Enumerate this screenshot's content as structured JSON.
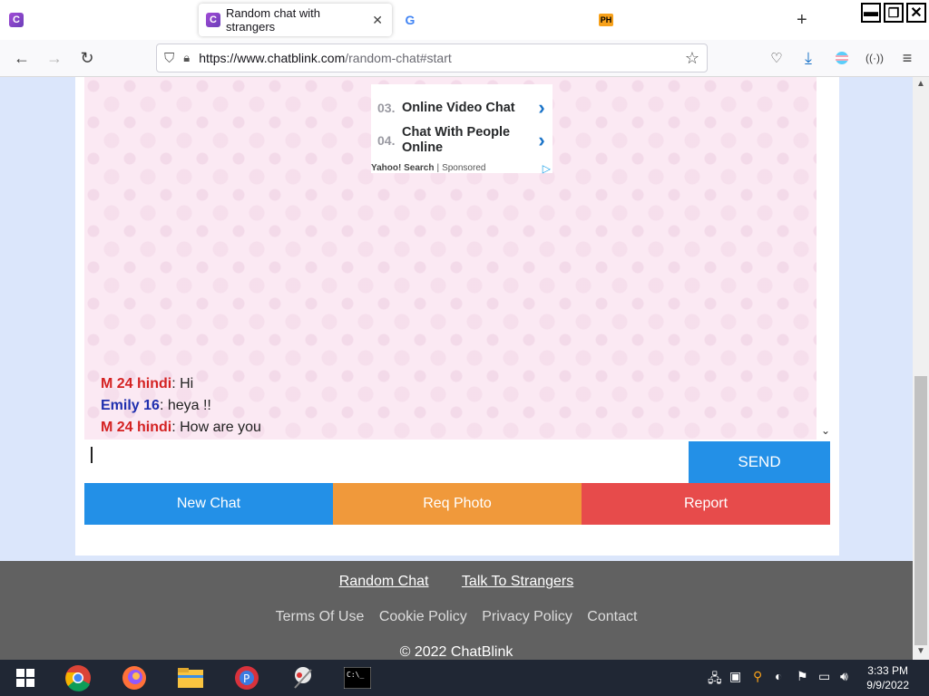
{
  "browser": {
    "tabs": [
      {
        "title": "",
        "favicon": "C"
      },
      {
        "title": "Random chat with strangers",
        "favicon": "C",
        "active": true
      },
      {
        "title": "",
        "favicon": "G"
      },
      {
        "title": "",
        "favicon": "PH"
      }
    ],
    "new_tab": "+",
    "window_controls": {
      "minimize": "▬",
      "restore": "❐",
      "close": "✕"
    },
    "url_host": "https://www.chatblink.com",
    "url_path": "/random-chat#start"
  },
  "ad": {
    "items": [
      {
        "num": "03.",
        "text": "Online Video Chat"
      },
      {
        "num": "04.",
        "text": "Chat With People Online"
      }
    ],
    "footer_brand": "Yahoo! Search",
    "footer_sep": "|",
    "footer_label": "Sponsored"
  },
  "messages": [
    {
      "name": "M 24 hindi",
      "text": ": Hi",
      "role": "stranger"
    },
    {
      "name": "Emily 16",
      "text": ": heya !!",
      "role": "you"
    },
    {
      "name": "M 24 hindi",
      "text": ": How are you",
      "role": "stranger"
    }
  ],
  "input": {
    "value": "",
    "send_label": "SEND"
  },
  "actions": {
    "new_chat": "New Chat",
    "req_photo": "Req Photo",
    "report": "Report"
  },
  "footer": {
    "links": [
      "Random Chat",
      "Talk To Strangers"
    ],
    "legal": [
      "Terms Of Use",
      "Cookie Policy",
      "Privacy Policy",
      "Contact"
    ],
    "copyright": "© 2022 ChatBlink"
  },
  "taskbar": {
    "time": "3:33 PM",
    "date": "9/9/2022"
  },
  "colors": {
    "send": "#2390e7",
    "new_chat": "#2390e7",
    "req_photo": "#f0993b",
    "report": "#e74b4b",
    "stranger_name": "#d42222",
    "you_name": "#1f2fae"
  }
}
